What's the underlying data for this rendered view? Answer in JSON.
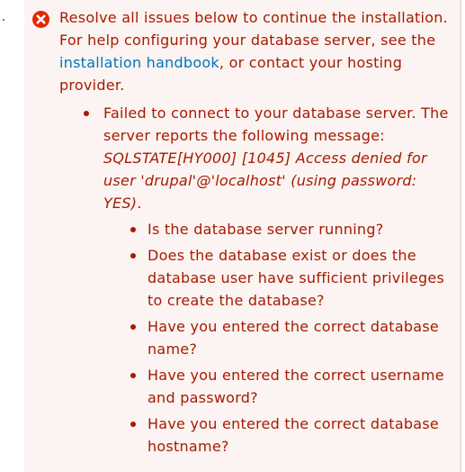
{
  "message": {
    "intro_prefix": "Resolve all issues below to continue the installation. For help configuring your database server, see the ",
    "handbook_link": "installation handbook",
    "intro_suffix": ", or contact your hosting provider.",
    "issue": {
      "text": "Failed to connect to your database server. The server reports the following message: ",
      "sqlstate": "SQLSTATE[HY000] [1045] Access denied for user 'drupal'@'localhost' (using password: YES)",
      "period": ".",
      "questions": [
        "Is the database server running?",
        "Does the database exist or does the database user have sufficient privileges to create the database?",
        "Have you entered the correct database name?",
        "Have you entered the correct username and password?",
        "Have you entered the correct database hostname?"
      ]
    }
  },
  "icons": {
    "error": "error-x-circle-icon"
  },
  "colors": {
    "error_text": "#a51b00",
    "panel_background": "#fcf4f2",
    "link": "#0074bd",
    "error_icon": "#e32700"
  }
}
